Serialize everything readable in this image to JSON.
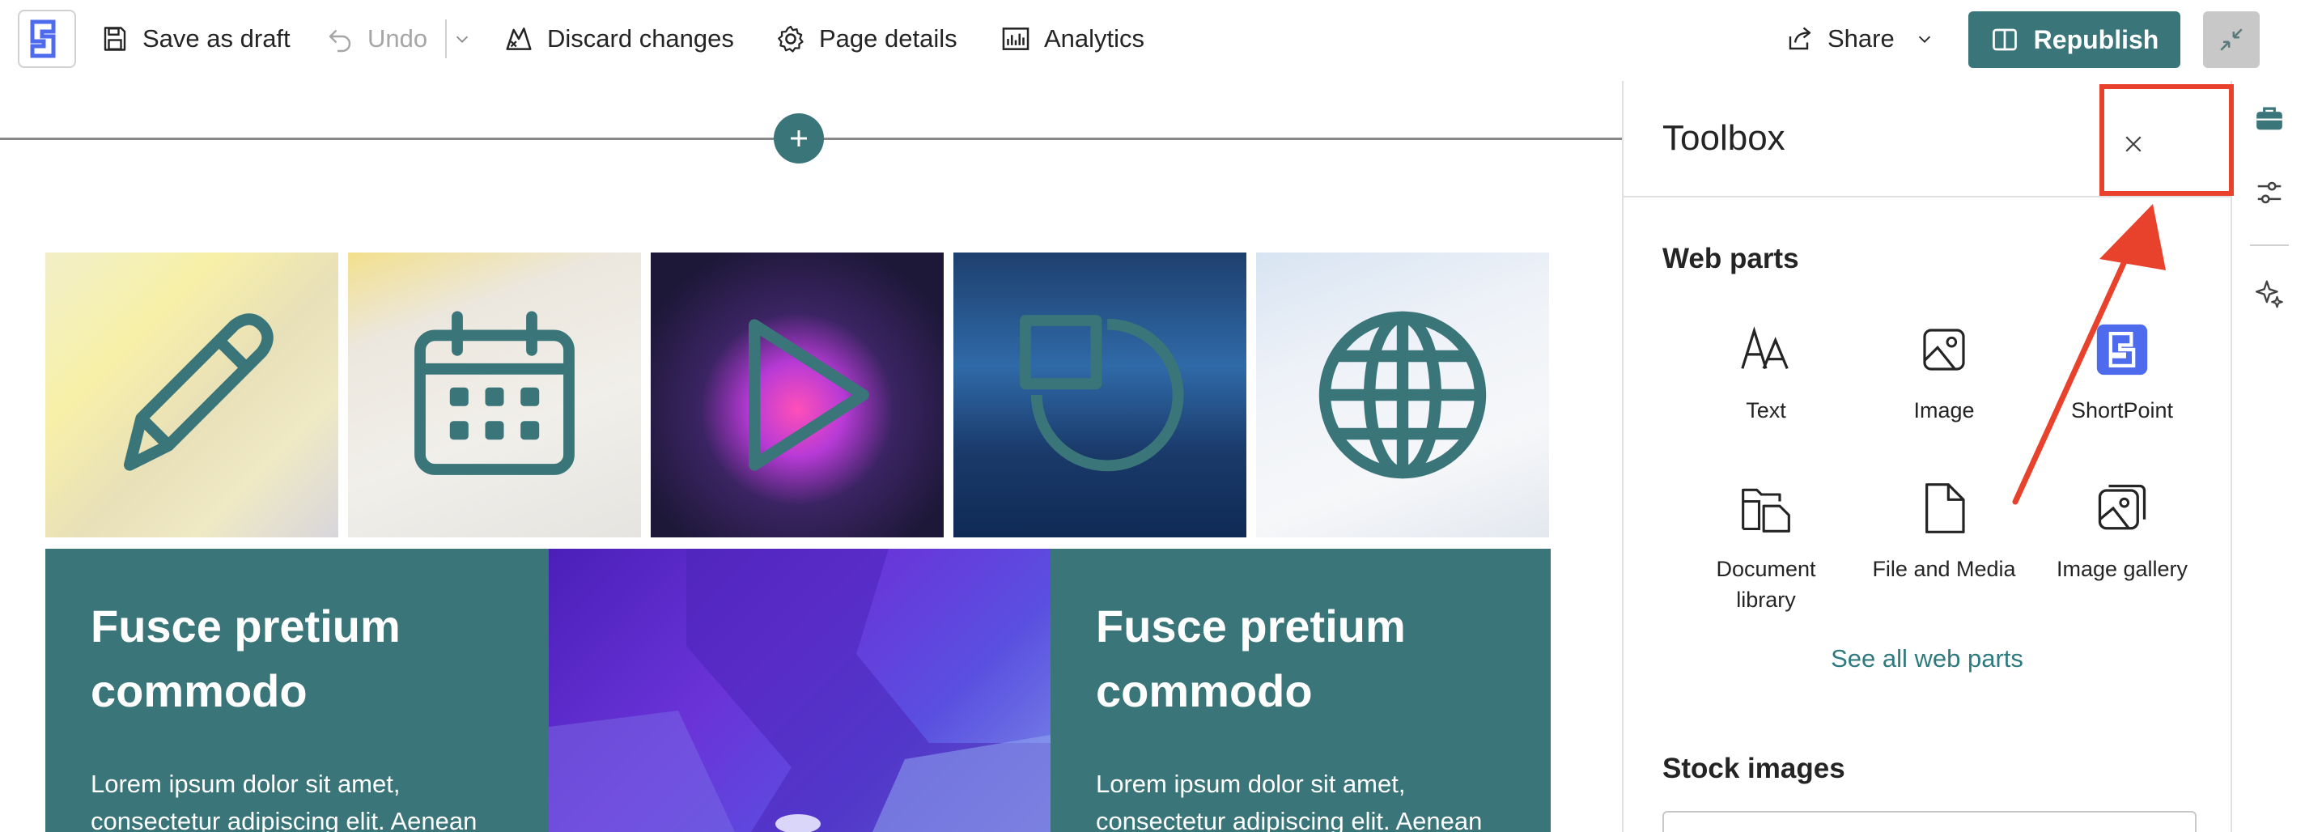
{
  "toolbar": {
    "save_draft": "Save as draft",
    "undo": "Undo",
    "discard": "Discard changes",
    "page_details": "Page details",
    "analytics": "Analytics",
    "share": "Share",
    "republish": "Republish"
  },
  "colors": {
    "accent": "#3a7579",
    "annotation": "#e8412c",
    "link": "#2f7a7e",
    "shortpoint_brand": "#4f6bed"
  },
  "tiles": [
    {
      "icon": "pencil-icon"
    },
    {
      "icon": "calendar-icon"
    },
    {
      "icon": "play-icon"
    },
    {
      "icon": "chart-circle-icon"
    },
    {
      "icon": "globe-icon"
    }
  ],
  "hero": {
    "left": {
      "title": "Fusce pretium commodo",
      "body": "Lorem ipsum dolor sit amet, consectetur adipiscing elit. Aenean"
    },
    "right": {
      "title": "Fusce pretium commodo",
      "body": "Lorem ipsum dolor sit amet, consectetur adipiscing elit. Aenean"
    }
  },
  "toolbox": {
    "title": "Toolbox",
    "web_parts_heading": "Web parts",
    "web_parts": [
      {
        "label": "Text",
        "icon": "text-icon"
      },
      {
        "label": "Image",
        "icon": "image-icon"
      },
      {
        "label": "ShortPoint",
        "icon": "shortpoint-icon"
      },
      {
        "label": "Document library",
        "icon": "document-library-icon"
      },
      {
        "label": "File and Media",
        "icon": "file-icon"
      },
      {
        "label": "Image gallery",
        "icon": "image-gallery-icon"
      }
    ],
    "see_all": "See all web parts",
    "stock_images_heading": "Stock images"
  }
}
